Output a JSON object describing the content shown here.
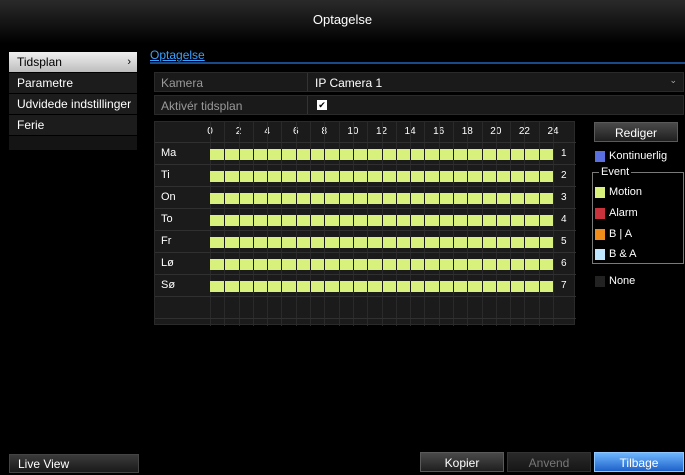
{
  "window": {
    "title": "Optagelse"
  },
  "sidebar": {
    "items": [
      {
        "label": "Tidsplan",
        "active": true,
        "arrow": "›"
      },
      {
        "label": "Parametre"
      },
      {
        "label": "Udvidede indstillinger"
      },
      {
        "label": "Ferie"
      }
    ],
    "live_view": "Live View"
  },
  "tabs": {
    "active": "Optagelse"
  },
  "form": {
    "camera_label": "Kamera",
    "camera_value": "IP Camera 1",
    "schedule_label": "Aktivér tidsplan",
    "schedule_checked": true,
    "check_glyph": "✔"
  },
  "schedule": {
    "hours": [
      "0",
      "2",
      "4",
      "6",
      "8",
      "10",
      "12",
      "14",
      "16",
      "18",
      "20",
      "22",
      "24"
    ],
    "days": [
      "Ma",
      "Ti",
      "On",
      "To",
      "Fr",
      "Lø",
      "Sø"
    ],
    "row_numbers": [
      "1",
      "2",
      "3",
      "4",
      "5",
      "6",
      "7"
    ],
    "mode": "Motion",
    "coverage_hours": [
      0,
      24
    ]
  },
  "legend": {
    "edit_button": "Rediger",
    "continuous": {
      "label": "Kontinuerlig",
      "color": "#5a6fe0"
    },
    "event_caption": "Event",
    "motion": {
      "label": "Motion",
      "color": "#d8f07c"
    },
    "alarm": {
      "label": "Alarm",
      "color": "#c8323a"
    },
    "m_or_a": {
      "label": "B | A",
      "color": "#f08c1a"
    },
    "m_and_a": {
      "label": "B & A",
      "color": "#bfe6ff"
    },
    "none": {
      "label": "None",
      "color": "#222222"
    }
  },
  "buttons": {
    "copy": "Kopier",
    "apply": "Anvend",
    "back": "Tilbage"
  }
}
